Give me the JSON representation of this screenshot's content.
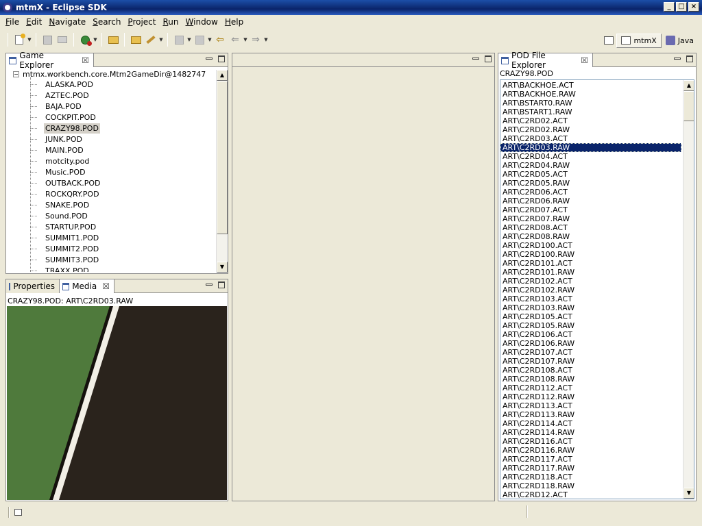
{
  "window": {
    "title": "mtmX - Eclipse SDK"
  },
  "menu": [
    {
      "mn": "F",
      "rest": "ile"
    },
    {
      "mn": "E",
      "rest": "dit"
    },
    {
      "mn": "N",
      "rest": "avigate"
    },
    {
      "mn": "S",
      "rest": "earch"
    },
    {
      "mn": "P",
      "rest": "roject"
    },
    {
      "mn": "R",
      "rest": "un"
    },
    {
      "mn": "W",
      "rest": "indow"
    },
    {
      "mn": "H",
      "rest": "elp"
    }
  ],
  "perspectives": {
    "active": "mtmX",
    "other": "Java"
  },
  "game_explorer": {
    "tab": "Game Explorer",
    "root": "mtmx.workbench.core.Mtm2GameDir@1482747",
    "selected_index": 4,
    "items": [
      "ALASKA.POD",
      "AZTEC.POD",
      "BAJA.POD",
      "COCKPIT.POD",
      "CRAZY98.POD",
      "JUNK.POD",
      "MAIN.POD",
      "motcity.pod",
      "Music.POD",
      "OUTBACK.POD",
      "ROCKQRY.POD",
      "SNAKE.POD",
      "Sound.POD",
      "STARTUP.POD",
      "SUMMIT1.POD",
      "SUMMIT2.POD",
      "SUMMIT3.POD",
      "TRAXX.POD"
    ]
  },
  "bottom_left": {
    "tab_properties": "Properties",
    "tab_media": "Media",
    "caption": "CRAZY98.POD: ART\\C2RD03.RAW",
    "colors": {
      "grass": "#4f7a3c",
      "asphalt": "#2a231c",
      "line": "#f2efe6"
    }
  },
  "pod_explorer": {
    "tab": "POD File Explorer",
    "pod_name": "CRAZY98.POD",
    "selected_index": 7,
    "files": [
      "ART\\BACKHOE.ACT",
      "ART\\BACKHOE.RAW",
      "ART\\BSTART0.RAW",
      "ART\\BSTART1.RAW",
      "ART\\C2RD02.ACT",
      "ART\\C2RD02.RAW",
      "ART\\C2RD03.ACT",
      "ART\\C2RD03.RAW",
      "ART\\C2RD04.ACT",
      "ART\\C2RD04.RAW",
      "ART\\C2RD05.ACT",
      "ART\\C2RD05.RAW",
      "ART\\C2RD06.ACT",
      "ART\\C2RD06.RAW",
      "ART\\C2RD07.ACT",
      "ART\\C2RD07.RAW",
      "ART\\C2RD08.ACT",
      "ART\\C2RD08.RAW",
      "ART\\C2RD100.ACT",
      "ART\\C2RD100.RAW",
      "ART\\C2RD101.ACT",
      "ART\\C2RD101.RAW",
      "ART\\C2RD102.ACT",
      "ART\\C2RD102.RAW",
      "ART\\C2RD103.ACT",
      "ART\\C2RD103.RAW",
      "ART\\C2RD105.ACT",
      "ART\\C2RD105.RAW",
      "ART\\C2RD106.ACT",
      "ART\\C2RD106.RAW",
      "ART\\C2RD107.ACT",
      "ART\\C2RD107.RAW",
      "ART\\C2RD108.ACT",
      "ART\\C2RD108.RAW",
      "ART\\C2RD112.ACT",
      "ART\\C2RD112.RAW",
      "ART\\C2RD113.ACT",
      "ART\\C2RD113.RAW",
      "ART\\C2RD114.ACT",
      "ART\\C2RD114.RAW",
      "ART\\C2RD116.ACT",
      "ART\\C2RD116.RAW",
      "ART\\C2RD117.ACT",
      "ART\\C2RD117.RAW",
      "ART\\C2RD118.ACT",
      "ART\\C2RD118.RAW",
      "ART\\C2RD12.ACT"
    ]
  },
  "toolbar_icons": [
    "new-wizard-icon",
    "save-icon",
    "print-icon",
    "debug-icon",
    "open-folder-icon",
    "open-project-icon",
    "run-wand-icon",
    "next-annotation-icon",
    "previous-annotation-icon",
    "last-edit-icon",
    "back-icon",
    "forward-icon"
  ]
}
